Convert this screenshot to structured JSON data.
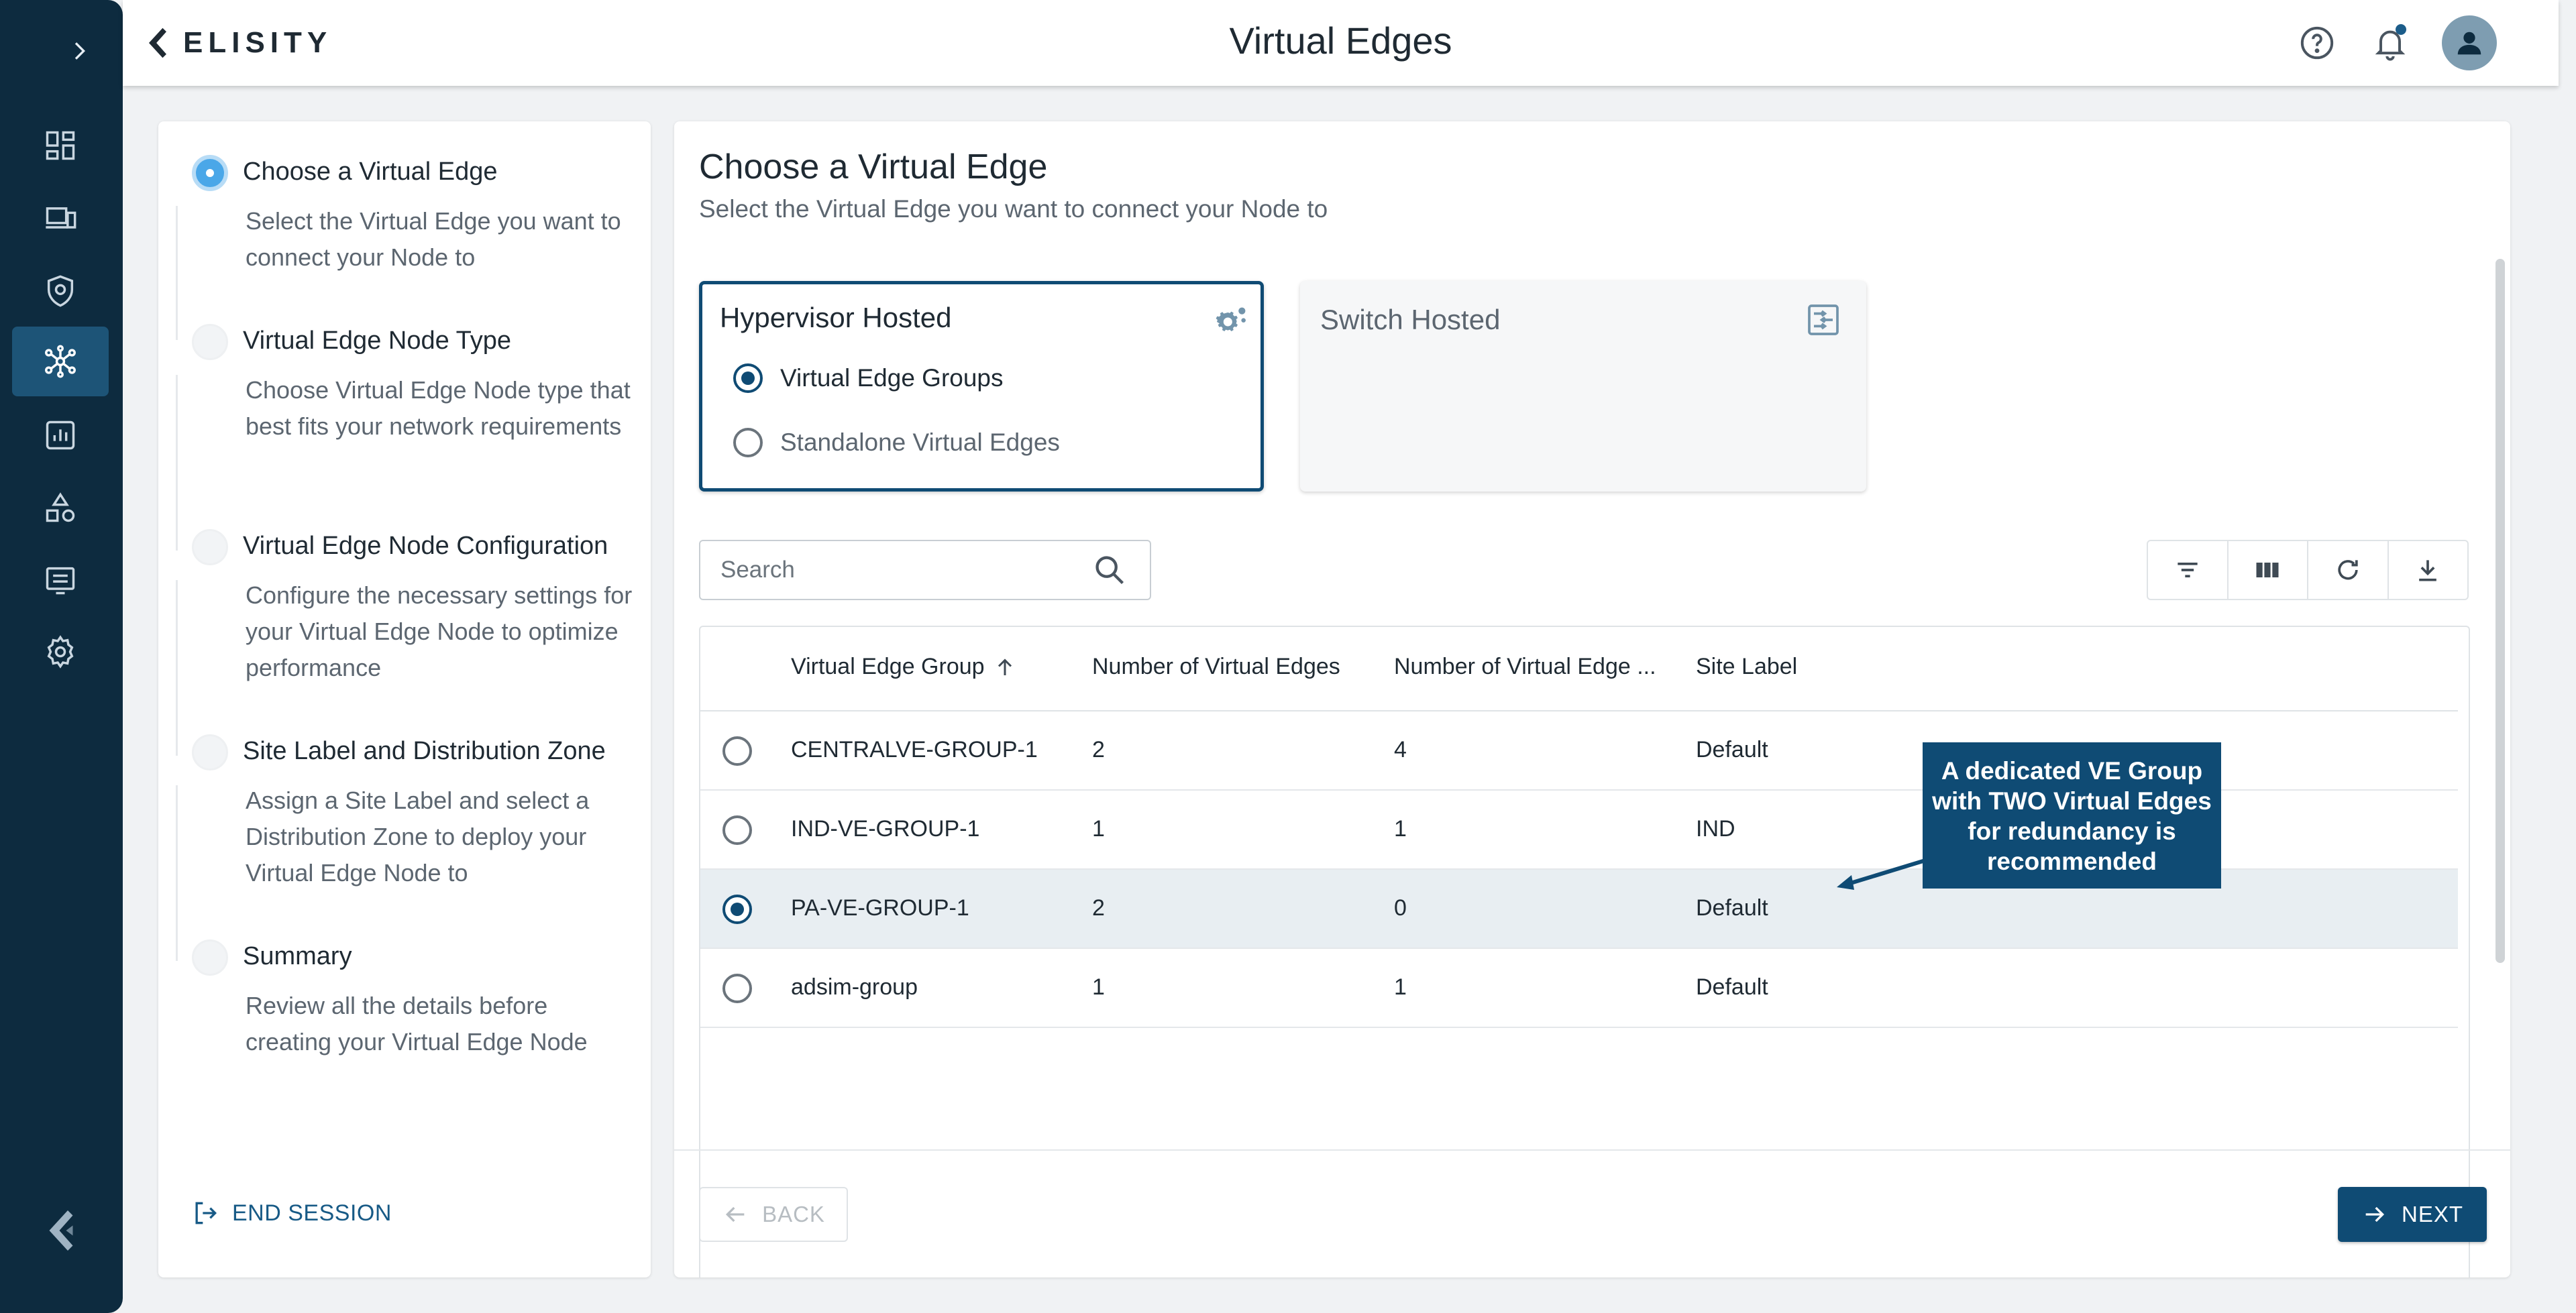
{
  "app": {
    "brand": "ELISITY",
    "page_title": "Virtual Edges"
  },
  "colors": {
    "nav_bg": "#0d2b3f",
    "accent": "#0f4b74",
    "active_step": "#4aa7e8"
  },
  "nav": {
    "items": [
      {
        "icon": "dashboard-icon"
      },
      {
        "icon": "devices-icon"
      },
      {
        "icon": "shield-icon"
      },
      {
        "icon": "network-icon",
        "active": true
      },
      {
        "icon": "analytics-icon"
      },
      {
        "icon": "shapes-icon"
      },
      {
        "icon": "logs-icon"
      },
      {
        "icon": "settings-icon"
      }
    ]
  },
  "header": {
    "icons": [
      "help-icon",
      "bell-icon",
      "user-avatar-icon"
    ]
  },
  "steps": [
    {
      "title": "Choose a Virtual Edge",
      "desc": "Select the Virtual Edge you want to connect your Node to",
      "active": true
    },
    {
      "title": "Virtual Edge Node Type",
      "desc": "Choose Virtual Edge Node type that best fits your network requirements"
    },
    {
      "title": "Virtual Edge Node Configuration",
      "desc": "Configure the necessary settings for your Virtual Edge Node to optimize performance"
    },
    {
      "title": "Site Label and Distribution Zone",
      "desc": "Assign a Site Label and select a Distribution Zone to deploy your Virtual Edge Node to"
    },
    {
      "title": "Summary",
      "desc": "Review all the details before creating your Virtual Edge Node"
    }
  ],
  "end_session": "END SESSION",
  "main": {
    "title": "Choose a Virtual Edge",
    "subtitle": "Select the Virtual Edge you want to connect your Node to",
    "cards": {
      "hypervisor": {
        "title": "Hypervisor Hosted",
        "options": [
          "Virtual Edge Groups",
          "Standalone Virtual Edges"
        ],
        "selected": "Virtual Edge Groups"
      },
      "switch": {
        "title": "Switch Hosted"
      }
    },
    "search": {
      "placeholder": "Search"
    },
    "toolbar_icons": [
      "filter-icon",
      "columns-icon",
      "refresh-icon",
      "download-icon"
    ],
    "table": {
      "columns": [
        "Virtual Edge Group",
        "Number of Virtual Edges",
        "Number of Virtual Edge ...",
        "Site Label"
      ],
      "rows": [
        {
          "group": "CENTRALVE-GROUP-1",
          "edges": "2",
          "nodes": "4",
          "site": "Default",
          "selected": false
        },
        {
          "group": "IND-VE-GROUP-1",
          "edges": "1",
          "nodes": "1",
          "site": "IND",
          "selected": false
        },
        {
          "group": "PA-VE-GROUP-1",
          "edges": "2",
          "nodes": "0",
          "site": "Default",
          "selected": true
        },
        {
          "group": "adsim-group",
          "edges": "1",
          "nodes": "1",
          "site": "Default",
          "selected": false
        }
      ]
    },
    "back_label": "BACK",
    "next_label": "NEXT"
  },
  "callout": {
    "text": "A dedicated VE Group with TWO Virtual Edges for redundancy is recommended"
  }
}
